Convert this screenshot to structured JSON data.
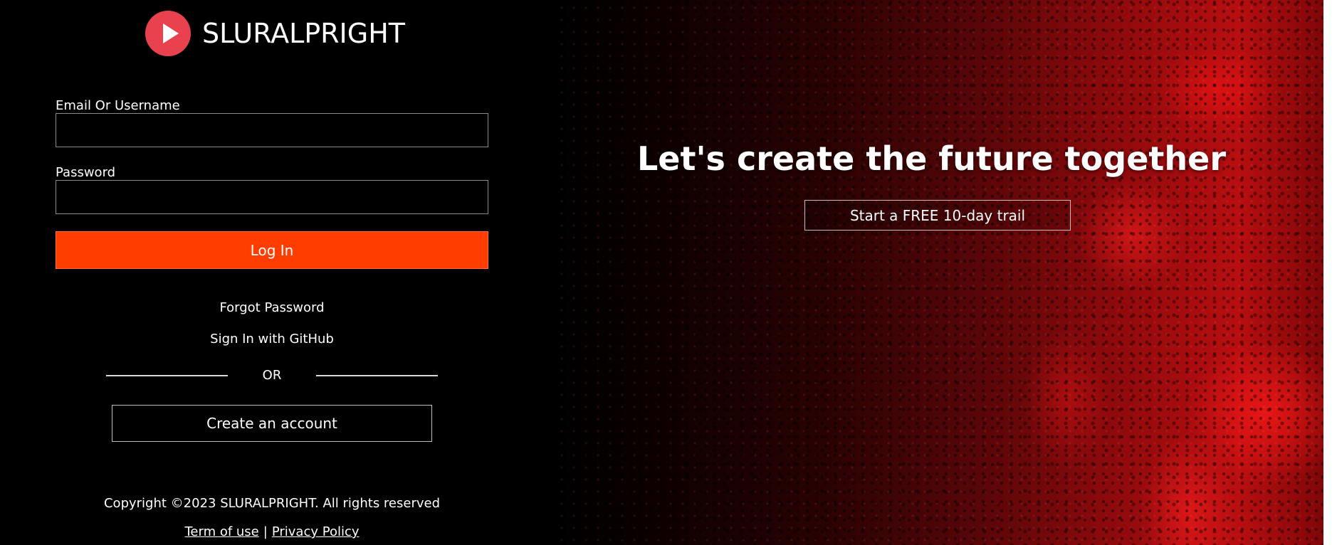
{
  "brand": {
    "name": "SLURALPRIGHT",
    "logo_icon": "play-icon",
    "logo_color": "#e9424e"
  },
  "login_form": {
    "email_label": "Email Or Username",
    "email_value": "",
    "email_placeholder": "",
    "password_label": "Password",
    "password_value": "",
    "password_placeholder": "",
    "login_button": "Log In",
    "login_button_color": "#ff3d00"
  },
  "links": {
    "forgot_password": "Forgot Password",
    "github_signin": "Sign In with GitHub",
    "divider_text": "OR",
    "create_account": "Create an account"
  },
  "footer": {
    "copyright": "Copyright ©2023 SLURALPRIGHT. All rights reserved",
    "terms": "Term of use",
    "separator": "|",
    "privacy": "Privacy Policy"
  },
  "hero": {
    "title": "Let's create the future together",
    "cta_button": "Start a FREE 10-day trail",
    "accent_color": "#b80e10"
  }
}
